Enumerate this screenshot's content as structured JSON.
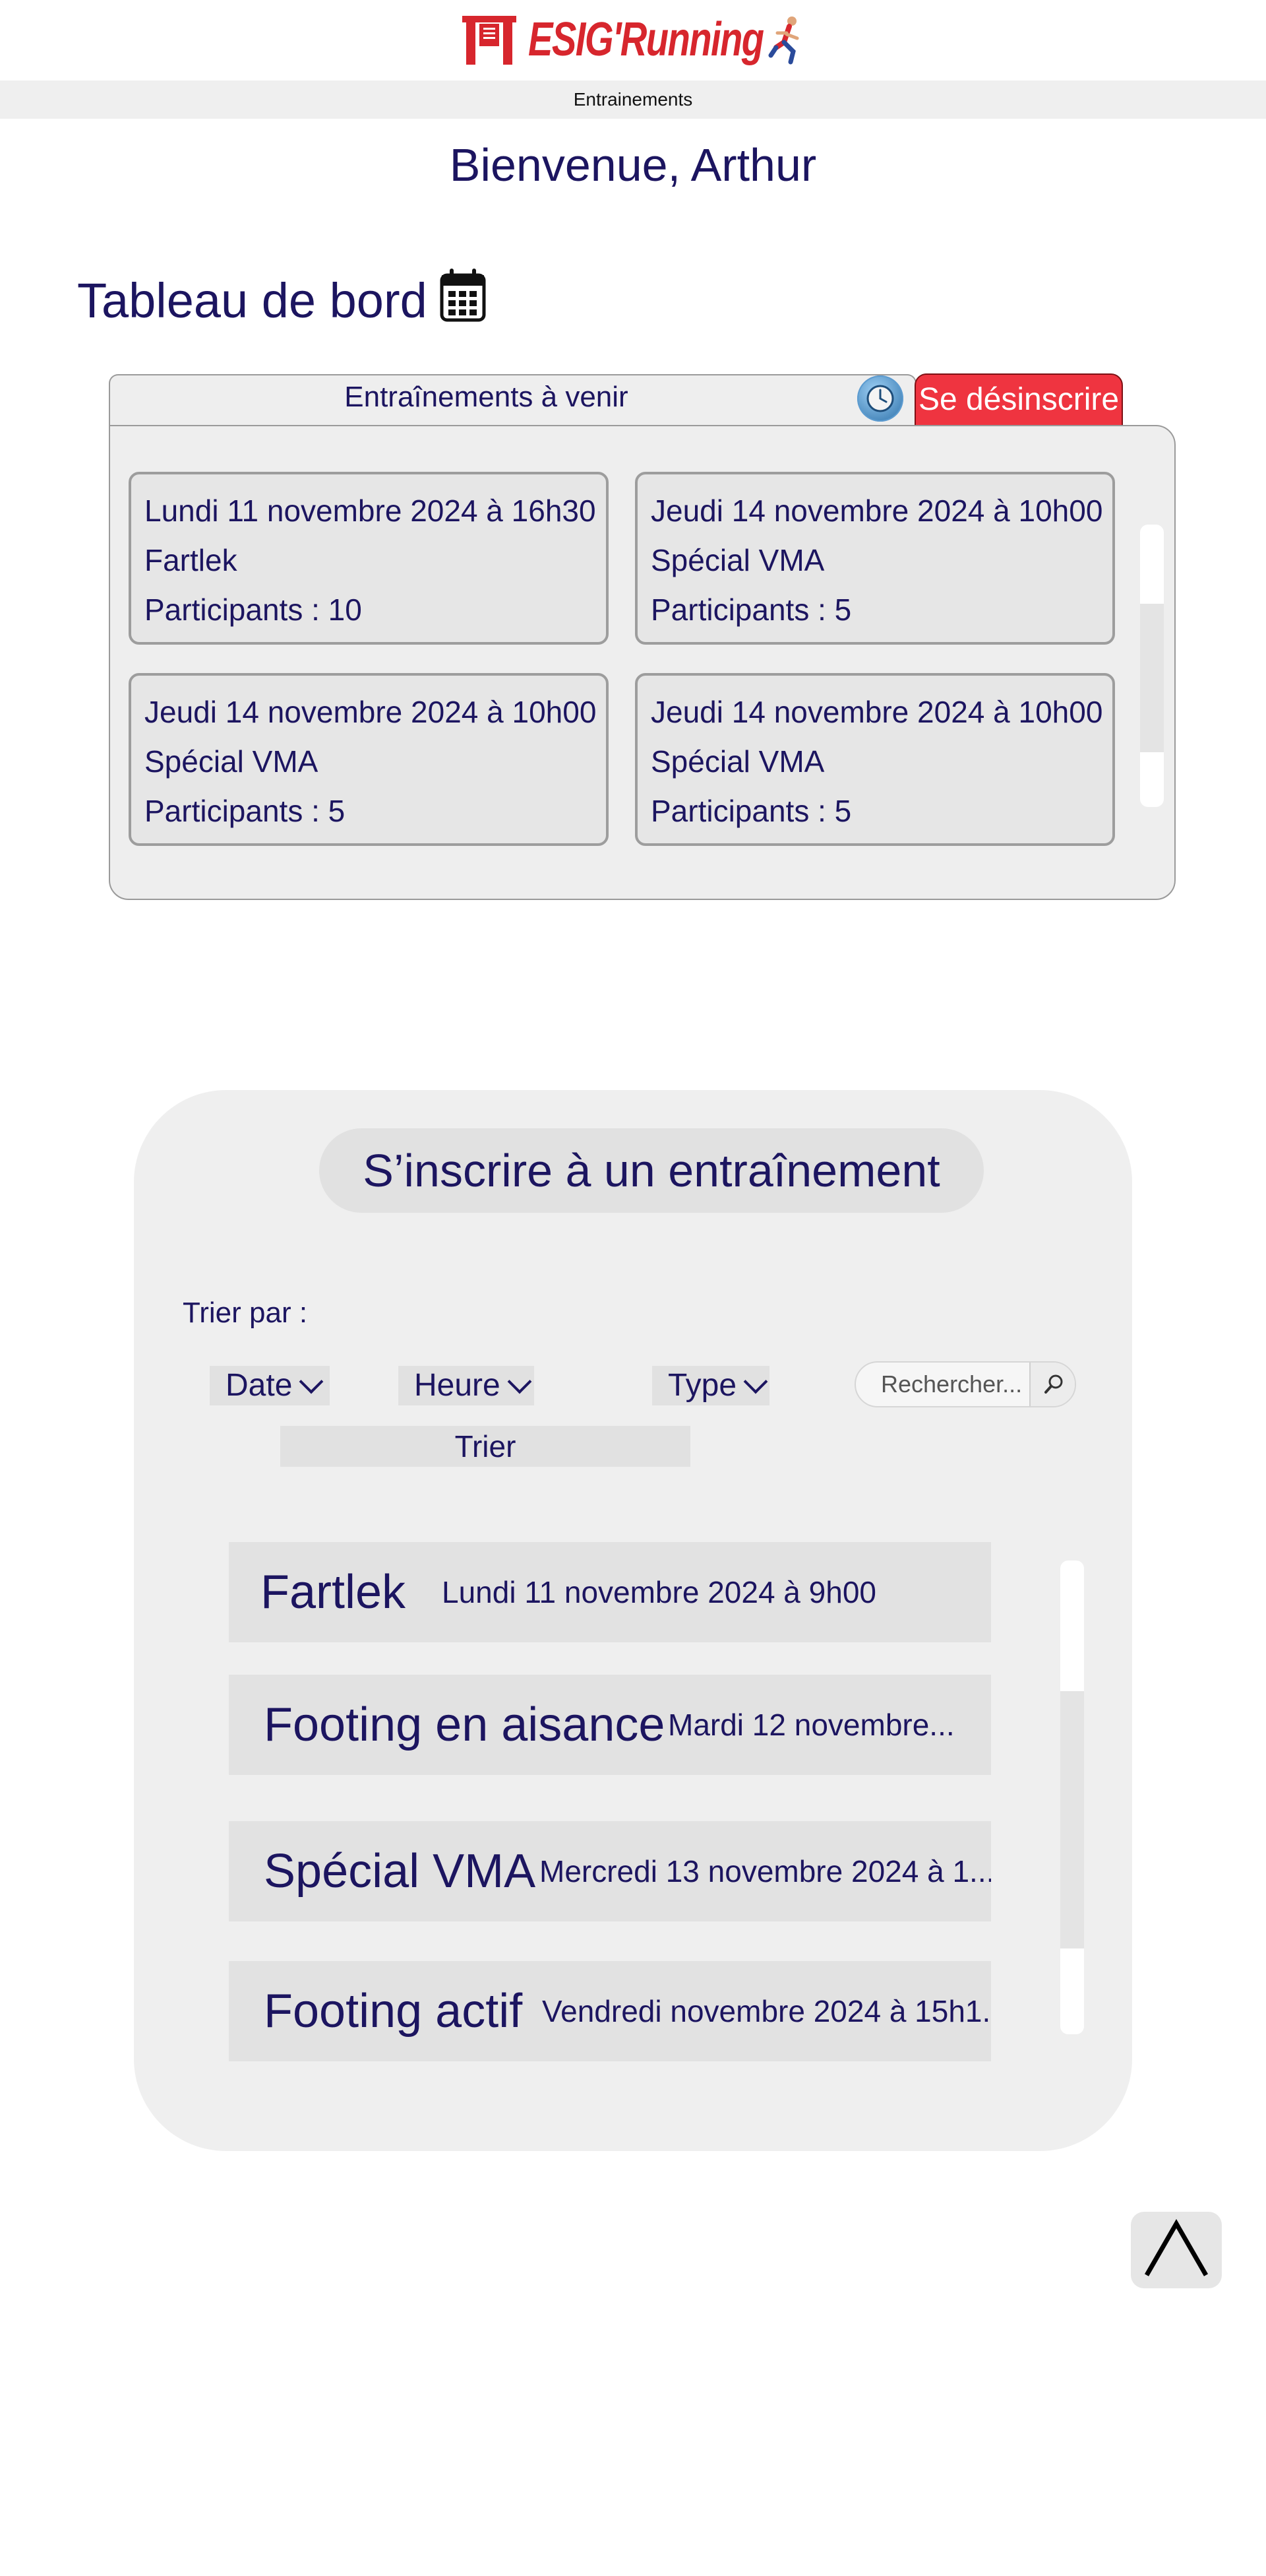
{
  "brand": {
    "name": "ESIG'Running",
    "color": "#d7262d"
  },
  "nav": {
    "link": "Entrainements"
  },
  "welcome": "Bienvenue, Arthur",
  "dashboard": {
    "title": "Tableau de bord",
    "tab_title": "Entraînements à venir",
    "unsubscribe_label": "Se désinscrire",
    "cards": [
      {
        "date": "Lundi 11 novembre 2024 à 16h30",
        "type": "Fartlek",
        "participants": "Participants : 10"
      },
      {
        "date": "Jeudi 14 novembre 2024 à 10h00",
        "type": "Spécial VMA",
        "participants": "Participants : 5"
      },
      {
        "date": "Jeudi 14 novembre 2024 à 10h00",
        "type": "Spécial VMA",
        "participants": "Participants : 5"
      },
      {
        "date": "Jeudi 14 novembre 2024 à 10h00",
        "type": "Spécial VMA",
        "participants": "Participants : 5"
      }
    ]
  },
  "register": {
    "title": "S’inscrire à un entraînement",
    "sort_label": "Trier par :",
    "filters": {
      "date": "Date",
      "hour": "Heure",
      "type": "Type"
    },
    "search_placeholder": "Rechercher...",
    "sort_button": "Trier",
    "trainings": [
      {
        "name": "Fartlek",
        "date": "Lundi 11 novembre 2024 à 9h00"
      },
      {
        "name": "Footing en aisance",
        "date": "Mardi 12 novembre..."
      },
      {
        "name": "Spécial VMA",
        "date": "Mercredi 13 novembre 2024 à 1..."
      },
      {
        "name": "Footing actif",
        "date": "Vendredi novembre 2024 à 15h1.."
      }
    ]
  },
  "colors": {
    "text": "#1c1560",
    "danger": "#ef3440",
    "panel": "#efefef"
  }
}
